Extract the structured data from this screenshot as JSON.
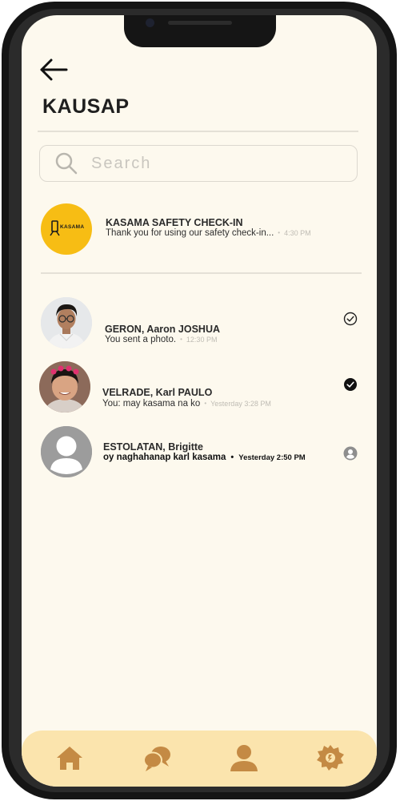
{
  "header": {
    "title": "KAUSAP"
  },
  "search": {
    "placeholder": "Search"
  },
  "pinned": {
    "name": "KASAMA SAFETY CHECK-IN",
    "preview": "Thank you for using our safety check-in...",
    "time": "4:30 PM",
    "logo_text": "KASAMA",
    "accent": "#f7bd14"
  },
  "conversations": [
    {
      "name": "GERON, Aaron JOSHUA",
      "preview": "You sent a photo.",
      "time": "12:30 PM",
      "status_icon": "sent-check-outline-icon"
    },
    {
      "name": "VELRADE, Karl PAULO",
      "preview": "You: may kasama na ko",
      "time": "Yesterday 3:28 PM",
      "status_icon": "seen-check-filled-icon"
    },
    {
      "name": "ESTOLATAN, Brigitte",
      "preview": "oy naghahanap karl kasama",
      "time": "Yesterday 2:50 PM",
      "status_icon": "unread-avatar-icon"
    }
  ],
  "bottom_nav": {
    "items": [
      "home-icon",
      "chat-bubbles-icon",
      "profile-icon",
      "settings-badge-icon"
    ],
    "background": "#fbe4ad",
    "icon_color": "#c48a44"
  },
  "theme": {
    "screen_background": "#fdf9ee"
  }
}
